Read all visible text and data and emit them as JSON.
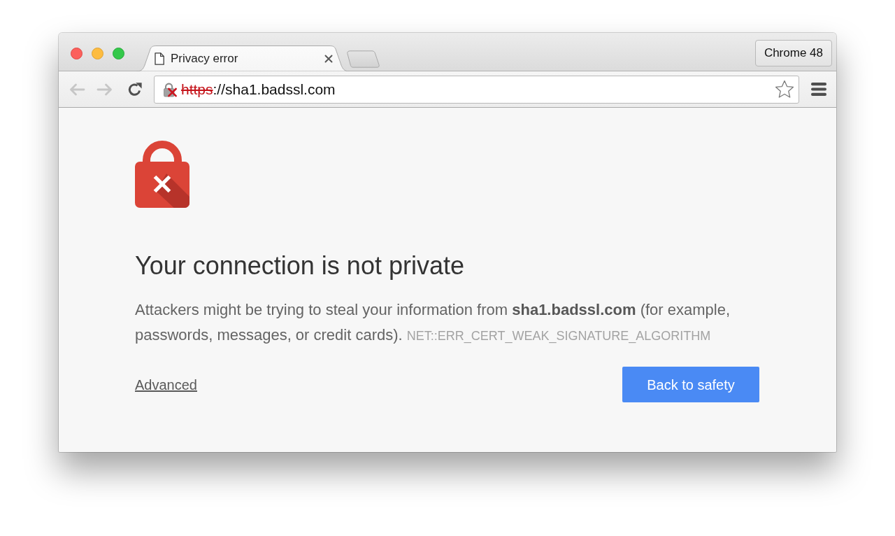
{
  "profile_button": {
    "label": "Chrome 48"
  },
  "tabs": [
    {
      "title": "Privacy error",
      "selected": true
    }
  ],
  "toolbar": {
    "back": {
      "disabled": true
    },
    "forward": {
      "disabled": true
    }
  },
  "address_bar": {
    "scheme": "https",
    "rest": "://sha1.badssl.com",
    "insecure": true,
    "bookmarked": false
  },
  "interstitial": {
    "heading": "Your connection is not private",
    "message": "Attackers might be trying to steal your information from **sha1.badssl.com** (for example, passwords, messages, or credit cards).",
    "error_code": "NET::ERR_CERT_WEAK_SIGNATURE_ALGORITHM",
    "advanced_link": "Advanced",
    "primary_button": "Back to safety"
  }
}
